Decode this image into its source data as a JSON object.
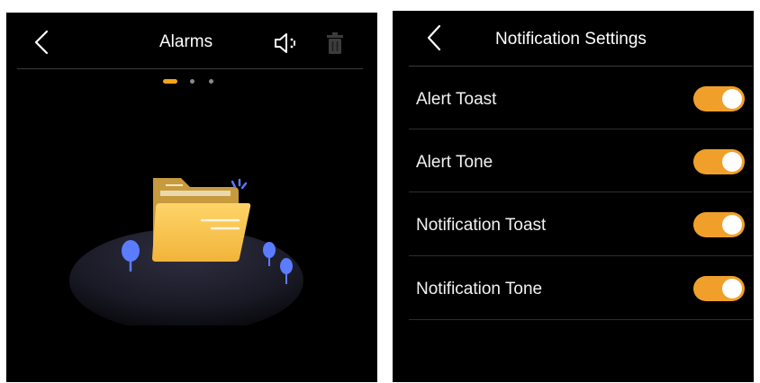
{
  "alarms_screen": {
    "title": "Alarms",
    "icons": {
      "back": "chevron-left-icon",
      "sound": "speaker-icon",
      "delete": "trash-icon"
    },
    "pager": {
      "total": 3,
      "active": 1
    },
    "illustration": "empty-folder-illustration",
    "colors": {
      "background": "#000000",
      "accent": "#f5a31a",
      "folder": "#f4c350",
      "tree": "#5b7cff"
    }
  },
  "notification_screen": {
    "title": "Notification Settings",
    "icons": {
      "back": "chevron-left-icon"
    },
    "settings": [
      {
        "label": "Alert Toast",
        "enabled": true
      },
      {
        "label": "Alert Tone",
        "enabled": true
      },
      {
        "label": "Notification Toast",
        "enabled": true
      },
      {
        "label": "Notification Tone",
        "enabled": true
      }
    ],
    "colors": {
      "background": "#000000",
      "toggle_on": "#f0a02a"
    }
  }
}
